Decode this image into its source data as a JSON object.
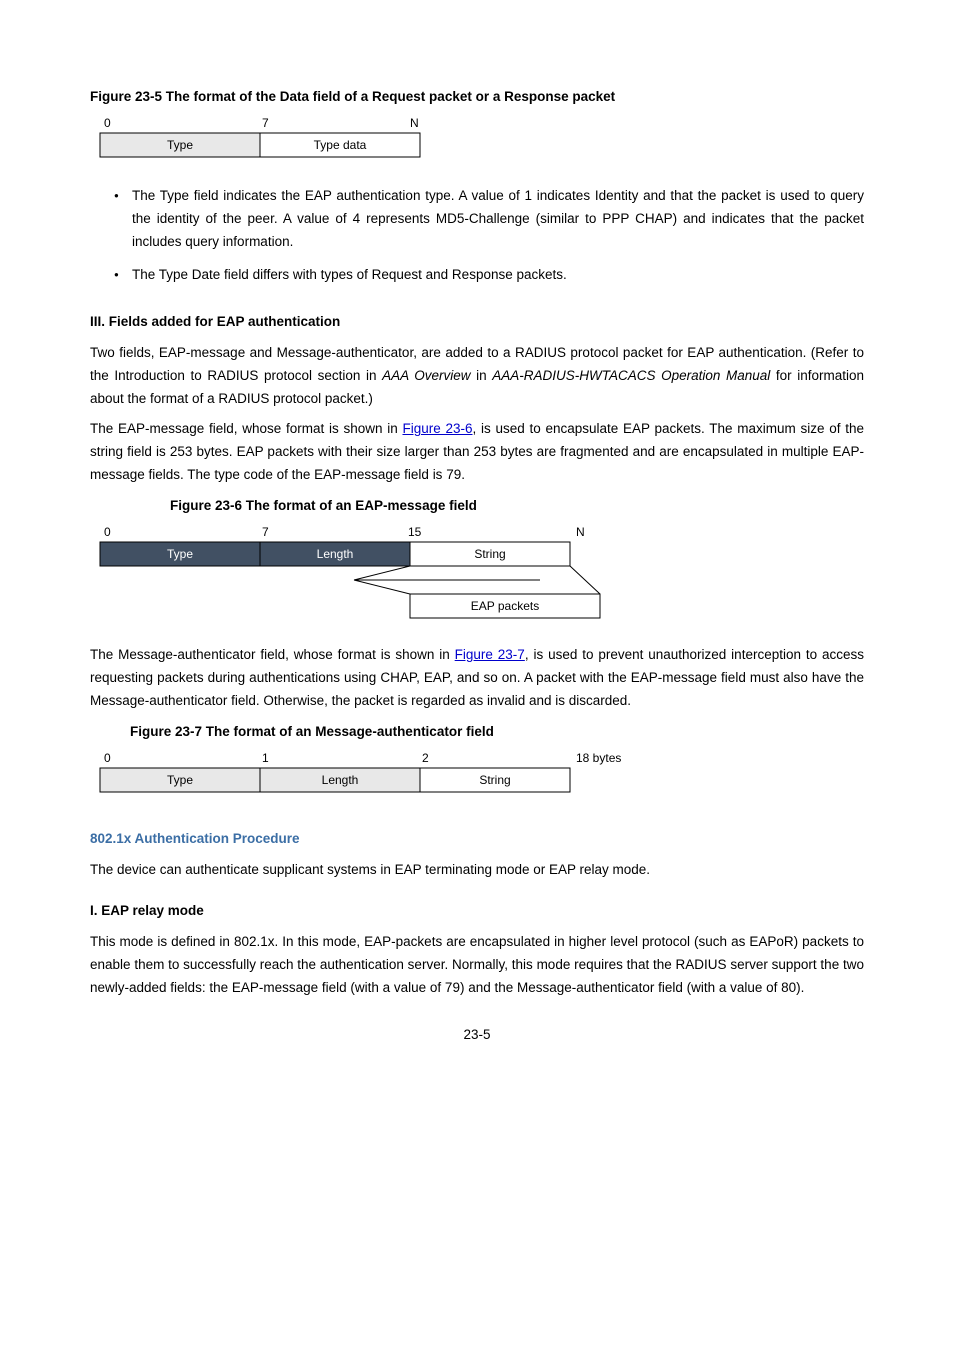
{
  "fig5": {
    "caption_prefix": "Figure 23-5",
    "caption": " The format of the Data field of a Request packet or a Response packet",
    "axis0": "0",
    "axis7": "7",
    "axisN": "N",
    "cell_type": "Type",
    "cell_data": "Type data"
  },
  "bullets": {
    "b1": "The Type field indicates the EAP authentication type. A value of 1 indicates Identity and that the packet is used to query the identity of the peer. A value of 4 represents MD5-Challenge (similar to PPP CHAP) and indicates that the packet includes query information.",
    "b2": "The Type Date field differs with types of Request and Response packets."
  },
  "h_radius": "III. Fields added for EAP authentication",
  "p_radius_1a": "Two fields, EAP-message and Message-authenticator, are added to a RADIUS protocol packet for EAP authentication. (Refer to the Introduction to RADIUS protocol section in ",
  "p_radius_1b": "AAA Overview",
  "p_radius_1c": " in ",
  "p_radius_1d": "AAA-RADIUS-HWTACACS Operation Manual",
  "p_radius_1e": " for information about the format of a RADIUS protocol packet.)",
  "p_eapmsg_a": "The EAP-message field, whose format is shown in ",
  "p_eapmsg_link": "Figure 23-6",
  "p_eapmsg_b": ", is used to encapsulate EAP packets. The maximum size of the string field is 253 bytes. EAP packets with their size larger than 253 bytes are fragmented and are encapsulated in multiple EAP-message fields. The type code of the EAP-message field is 79.",
  "fig6": {
    "caption_prefix": "Figure 23-6",
    "caption": " The format of an EAP-message field",
    "axis0": "0",
    "axis7": "7",
    "axis15": "15",
    "axisN": "N",
    "cell_type": "Type",
    "cell_length": "Length",
    "cell_string": "String",
    "cell_eap": "EAP packets"
  },
  "p_msgauth_a": "The Message-authenticator field, whose format is shown in ",
  "p_msgauth_link": "Figure 23-7",
  "p_msgauth_b": ", is used to prevent unauthorized interception to access requesting packets during authentications using CHAP, EAP, and so on. A packet with the EAP-message field must also have the Message-authenticator field. Otherwise, the packet is regarded as invalid and is discarded.",
  "fig7": {
    "caption_prefix": "Figure 23-7",
    "caption": " The format of an Message-authenticator field",
    "axis0": "0",
    "axis1": "1",
    "axis2": "2",
    "axis18": "18 bytes",
    "cell_type": "Type",
    "cell_length": "Length",
    "cell_string": "String"
  },
  "h_auth": "802.1x Authentication Procedure",
  "p_auth_intro": "The device can authenticate supplicant systems in EAP terminating mode or EAP relay mode.",
  "h_relay": "I. EAP relay mode",
  "p_relay": "This mode is defined in 802.1x. In this mode, EAP-packets are encapsulated in higher level protocol (such as EAPoR) packets to enable them to successfully reach the authentication server. Normally, this mode requires that the RADIUS server support the two newly-added fields: the EAP-message field (with a value of 79) and the Message-authenticator field (with a value of 80).",
  "pagenum": "23-5"
}
